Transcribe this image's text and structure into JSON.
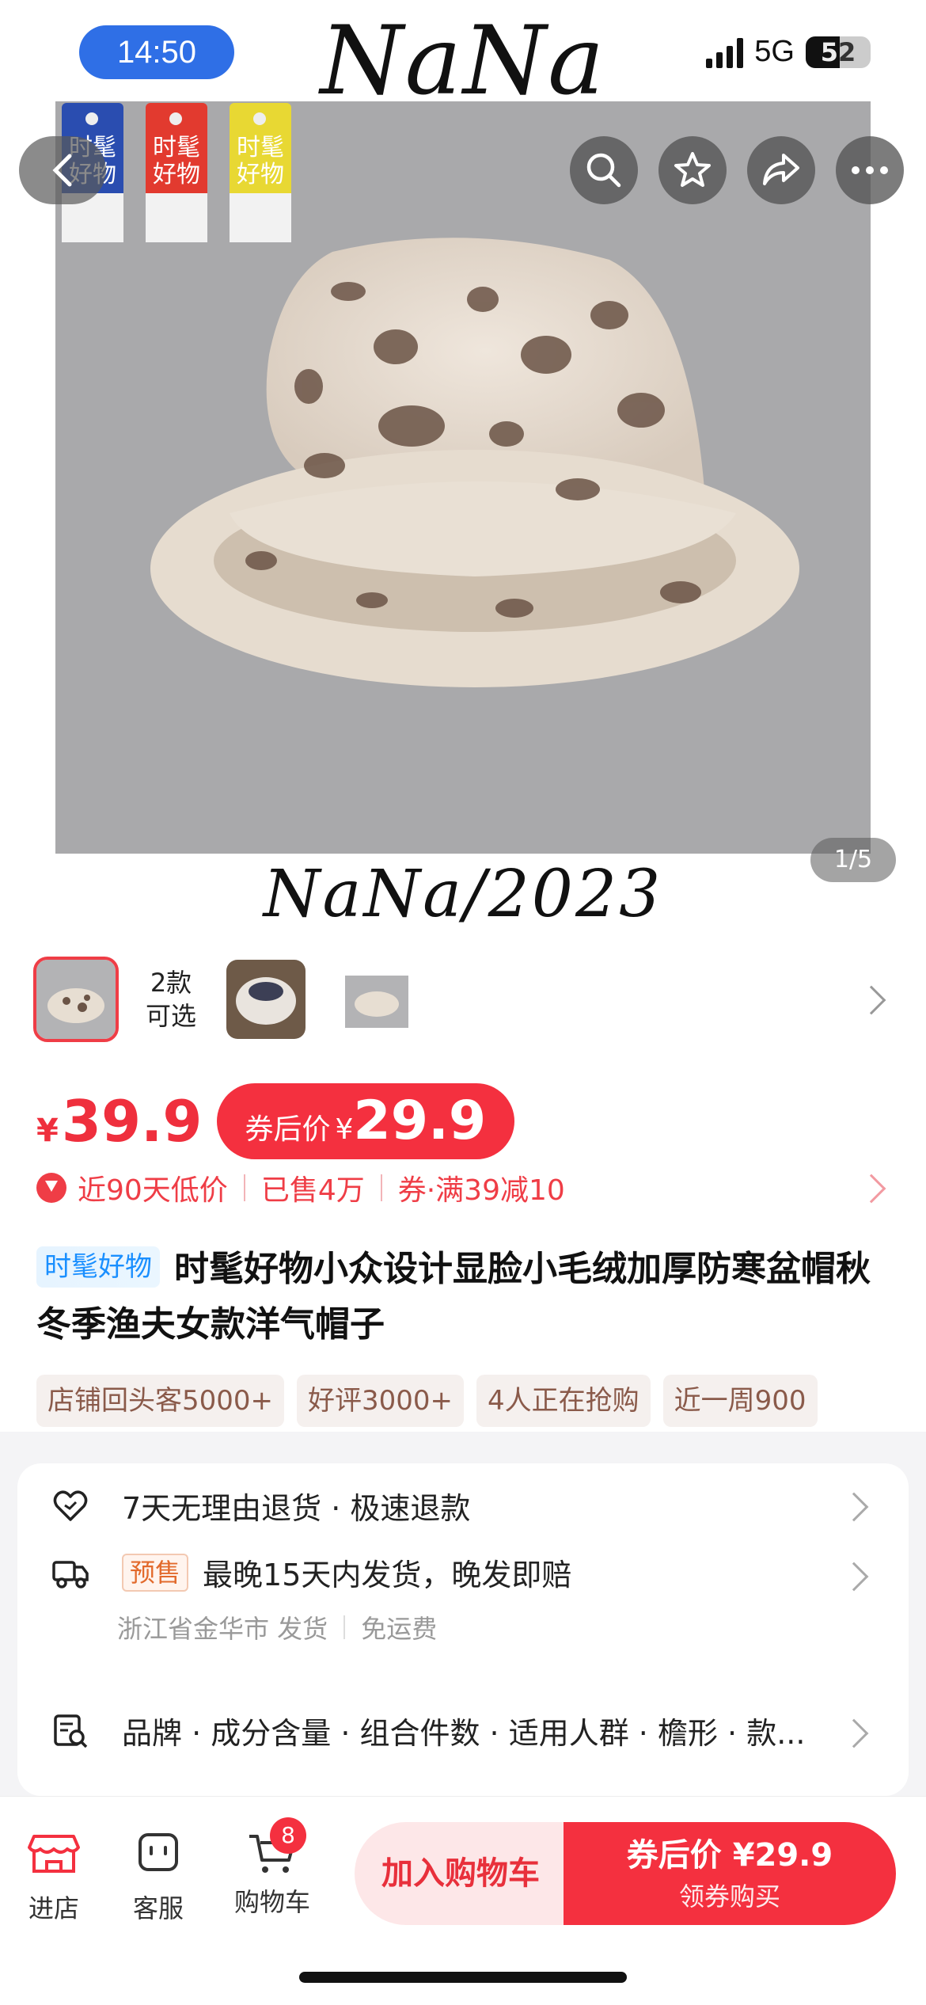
{
  "status_bar": {
    "time": "14:50",
    "network": "5G",
    "battery": "52",
    "battery_level": 0.52
  },
  "hero": {
    "brand_top": "NaNa",
    "brand_bottom": "NaNa/2023",
    "page_indicator": "1/5",
    "tag_cards": [
      {
        "text": "时髦好物",
        "color": "#2a4db0"
      },
      {
        "text": "时髦好物",
        "color": "#e23a2f"
      },
      {
        "text": "时髦好物",
        "color": "#e8d833"
      }
    ],
    "action_icons": [
      "back-icon",
      "search-icon",
      "star-icon",
      "share-icon",
      "more-icon"
    ]
  },
  "variants": {
    "count_label_line1": "2款",
    "count_label_line2": "可选"
  },
  "price": {
    "currency": "¥",
    "original": "39.9",
    "coupon_label": "券后价",
    "coupon_price": "29.9"
  },
  "hints": {
    "low_price": "近90天低价",
    "sold": "已售4万",
    "coupon": "券·满39减10"
  },
  "title": {
    "badge": "时髦好物",
    "text": "时髦好物小众设计显脸小毛绒加厚防寒盆帽秋冬季渔夫女款洋气帽子"
  },
  "chips": [
    "店铺回头客5000+",
    "好评3000+",
    "4人正在抢购",
    "近一周900"
  ],
  "services": {
    "returns": "7天无理由退货 · 极速退款",
    "presale_tag": "预售",
    "shipping": "最晚15天内发货，晚发即赔",
    "origin": "浙江省金华市 发货",
    "freight": "免运费",
    "params": "品牌 · 成分含量 · 组合件数 · 适用人群 · 檐形 · 款..."
  },
  "bottom_bar": {
    "store": "进店",
    "service": "客服",
    "cart": "购物车",
    "cart_count": "8",
    "add_to_cart": "加入购物车",
    "buy_line1": "券后价 ¥29.9",
    "buy_line2": "领券购买"
  },
  "colors": {
    "accent": "#f4303f",
    "badge_blue": "#1a8fff"
  }
}
